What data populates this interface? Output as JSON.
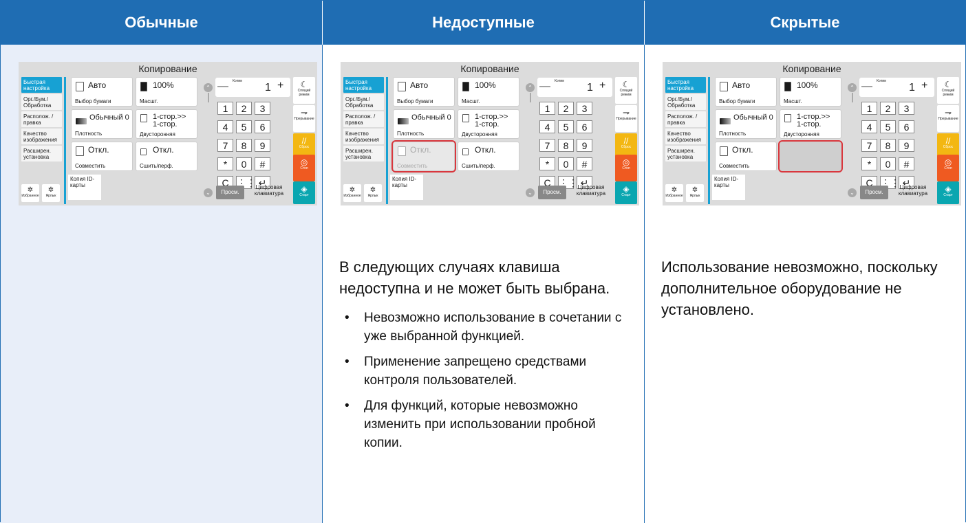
{
  "columns": [
    {
      "header": "Обычные"
    },
    {
      "header": "Недоступные",
      "text": "В следующих случаях клавиша недоступна и не может быть выбрана.",
      "bullets": [
        "Невозможно использование в сочетании с уже выбранной функцией.",
        "Применение запрещено средствами контроля пользователей.",
        "Для функций, которые невозможно изменить при использовании пробной копии."
      ]
    },
    {
      "header": "Скрытые",
      "text": "Использование невозможно, поскольку дополнительное оборудование не установлено."
    }
  ],
  "screen": {
    "title": "Копирование",
    "menu": [
      "Быстрая настройка",
      "Орг./Бум./ Обработка",
      "Располож. /правка",
      "Качество изображения",
      "Расширен. установка"
    ],
    "tiles": {
      "paper_value": "Авто",
      "paper_label": "Выбор бумаги",
      "zoom_value": "100%",
      "zoom_label": "Масшт.",
      "density_value": "Обычный 0",
      "density_label": "Плотность",
      "duplex_value": "1-стор.>> 1-стор.",
      "duplex_label": "Двусторонняя",
      "combine_value": "Откл.",
      "combine_label": "Совместить",
      "staple_value": "Откл.",
      "staple_label": "Сшить/перф.",
      "idcard_label": "Копия ID-карты"
    },
    "copies_label": "Копии",
    "copies_value": "1",
    "minus": "—",
    "plus": "+",
    "keys": [
      "1",
      "2",
      "3",
      "4",
      "5",
      "6",
      "7",
      "8",
      "9",
      "*",
      "0",
      "#",
      "C",
      "⋮⋮",
      "↵"
    ],
    "side": {
      "sleep": "Спящий режим",
      "interrupt": "Прерывание",
      "reset": "Сброс",
      "stop": "Стоп",
      "start": "Старт"
    },
    "preview": "Просм.",
    "keypad": "Цифровая клавиатура",
    "favorites": "Избранное",
    "shortcuts": "Ярлык"
  }
}
